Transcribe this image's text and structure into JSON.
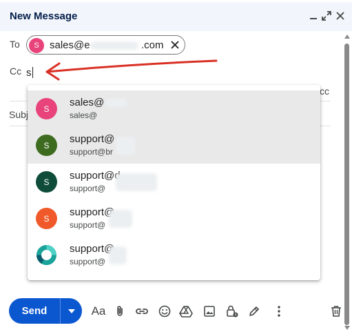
{
  "window": {
    "title": "New Message",
    "controls": [
      "minimize-icon",
      "expand-icon",
      "close-icon"
    ]
  },
  "to": {
    "label": "To",
    "chip": {
      "avatar_letter": "S",
      "text": "sales@e",
      "domain_suffix": ".com",
      "avatar_color": "#e8437a"
    }
  },
  "cc": {
    "label": "Cc",
    "value": "s"
  },
  "subject": {
    "label_visible": "Subj"
  },
  "bcc_partial": "cc",
  "suggestions": [
    {
      "letter": "S",
      "name": "sales@",
      "email": "sales@",
      "color": "#e8437a"
    },
    {
      "letter": "S",
      "name": "support@",
      "email": "support@br",
      "color": "#3d6b1f"
    },
    {
      "letter": "S",
      "name": "support@d",
      "email": "support@",
      "color": "#0f4d3a"
    },
    {
      "letter": "S",
      "name": "support@",
      "email": "support@",
      "color": "#f05a2a"
    },
    {
      "letter": "",
      "name": "support@",
      "email": "support@",
      "color": "#1aa39a"
    }
  ],
  "toolbar": {
    "send_label": "Send",
    "format_label": "Aa",
    "icons": [
      "formatting-options-icon",
      "attach-icon",
      "link-icon",
      "emoji-icon",
      "drive-icon",
      "photo-icon",
      "confidential-lock-icon",
      "signature-pen-icon",
      "more-options-icon",
      "discard-trash-icon"
    ]
  },
  "accent_colors": {
    "send": "#0b57d0",
    "arrow": "#d93025",
    "header": "#f2f6fc"
  }
}
